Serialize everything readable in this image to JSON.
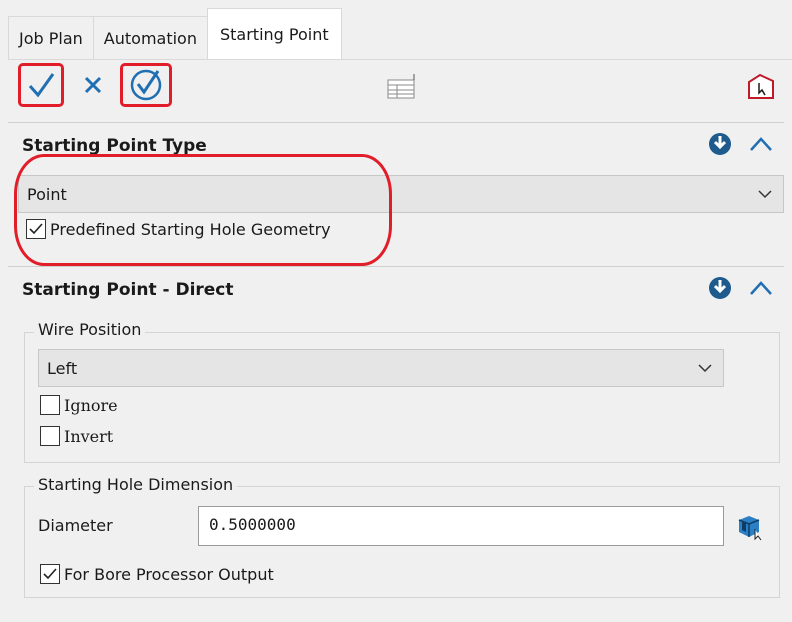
{
  "tabs": [
    {
      "label": "Job Plan"
    },
    {
      "label": "Automation"
    },
    {
      "label": "Starting Point",
      "active": true
    }
  ],
  "toolbar": {
    "ok_icon": "checkmark-icon",
    "cancel_icon": "close-icon",
    "apply_icon": "circle-check-icon",
    "table_icon": "table-icon",
    "point_icon": "house-cursor-icon"
  },
  "starting_point_type": {
    "title": "Starting Point Type",
    "type_value": "Point",
    "predefined_label": "Predefined Starting Hole Geometry",
    "predefined_checked": true
  },
  "starting_point_direct": {
    "title": "Starting Point - Direct",
    "wire_position": {
      "label": "Wire Position",
      "value": "Left",
      "ignore_label": "Ignore",
      "ignore_checked": false,
      "invert_label": "Invert",
      "invert_checked": false
    },
    "starting_hole": {
      "label": "Starting Hole Dimension",
      "diameter_label": "Diameter",
      "diameter_value": "0.5000000",
      "bore_label": "For Bore Processor Output",
      "bore_checked": true
    }
  },
  "colors": {
    "accent": "#1f6fb2",
    "annotation": "#e11d2a",
    "header_icon": "#1e5a8c"
  }
}
